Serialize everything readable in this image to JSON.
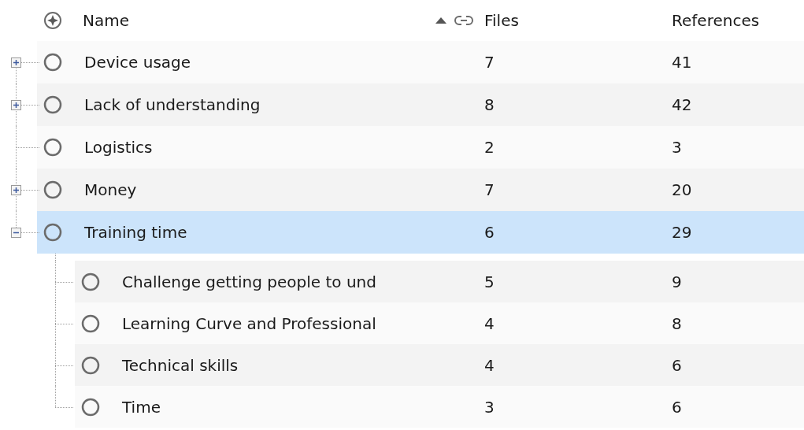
{
  "columns": [
    {
      "label": "Name"
    },
    {
      "label": "Files"
    },
    {
      "label": "References"
    }
  ],
  "nodes": [
    {
      "name": "Device usage",
      "files": "7",
      "references": "41",
      "expanded": false,
      "selected": false
    },
    {
      "name": "Lack of understanding",
      "files": "8",
      "references": "42",
      "expanded": false,
      "selected": false
    },
    {
      "name": "Logistics",
      "files": "2",
      "references": "3",
      "selected": false
    },
    {
      "name": "Money",
      "files": "7",
      "references": "20",
      "expanded": false,
      "selected": false
    },
    {
      "name": "Training time",
      "files": "6",
      "references": "29",
      "expanded": true,
      "selected": true,
      "children": [
        {
          "name": "Challenge getting people to und",
          "files": "5",
          "references": "9",
          "selected": false
        },
        {
          "name": "Learning Curve and Professional",
          "files": "4",
          "references": "8",
          "selected": false
        },
        {
          "name": "Technical skills",
          "files": "4",
          "references": "6",
          "selected": false
        },
        {
          "name": "Time",
          "files": "3",
          "references": "6",
          "selected": false
        }
      ]
    }
  ]
}
